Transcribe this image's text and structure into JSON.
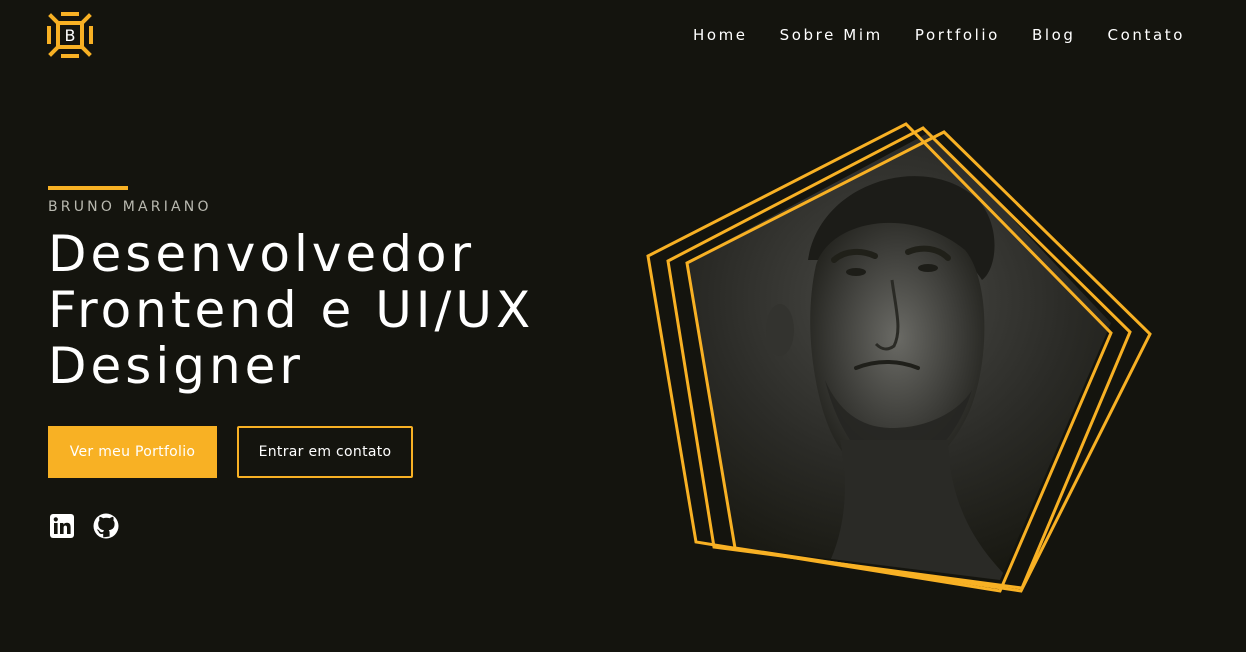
{
  "brand": {
    "logo_letter": "B",
    "accent_color": "#f8b124",
    "background_color": "#14140e"
  },
  "nav": {
    "items": [
      {
        "label": "Home"
      },
      {
        "label": "Sobre Mim"
      },
      {
        "label": "Portfolio"
      },
      {
        "label": "Blog"
      },
      {
        "label": "Contato"
      }
    ]
  },
  "hero": {
    "eyebrow": "BRUNO MARIANO",
    "headline": {
      "line1": "Desenvolvedor",
      "line2": "Frontend e UI/UX",
      "line3": "Designer"
    },
    "primary_button": "Ver meu Portfolio",
    "secondary_button": "Entrar em contato",
    "social_icons": [
      "linkedin-icon",
      "github-icon"
    ],
    "portrait_frame": "pentagon"
  }
}
